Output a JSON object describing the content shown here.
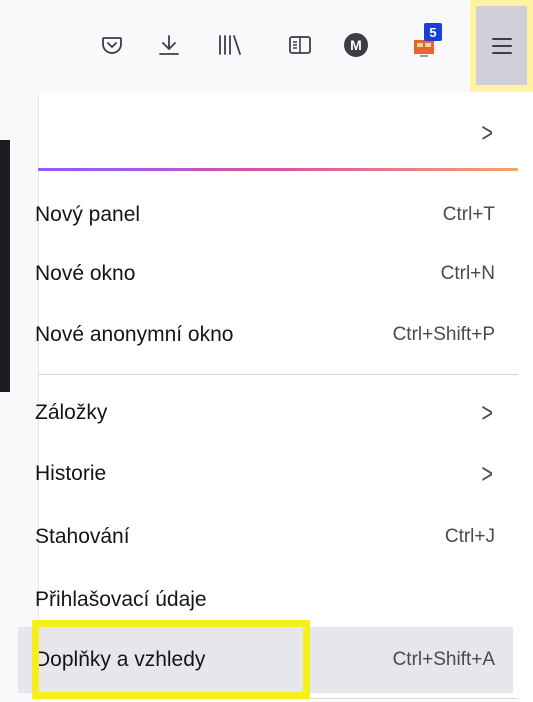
{
  "toolbar": {
    "icons": [
      "pocket-icon",
      "download-icon",
      "library-icon",
      "reader-view-icon",
      "account-avatar-icon",
      "extension-icon",
      "hamburger-menu-icon"
    ],
    "avatar_letter": "M",
    "extension_badge": "5"
  },
  "menu": {
    "account_row": {
      "chevron": ">"
    },
    "items": [
      {
        "label": "Nový panel",
        "shortcut": "Ctrl+T"
      },
      {
        "label": "Nové okno",
        "shortcut": "Ctrl+N"
      },
      {
        "label": "Nové anonymní okno",
        "shortcut": "Ctrl+Shift+P"
      },
      {
        "label": "Záložky",
        "shortcut": ">"
      },
      {
        "label": "Historie",
        "shortcut": ">"
      },
      {
        "label": "Stahování",
        "shortcut": "Ctrl+J"
      },
      {
        "label": "Přihlašovací údaje",
        "shortcut": ""
      },
      {
        "label": "Doplňky a vzhledy",
        "shortcut": "Ctrl+Shift+A"
      }
    ]
  },
  "colors": {
    "highlight": "#f7ee1e",
    "badge": "#1a3fd8",
    "accent_gradient": [
      "#9059ff",
      "#d356a6",
      "#f0a76a"
    ]
  }
}
